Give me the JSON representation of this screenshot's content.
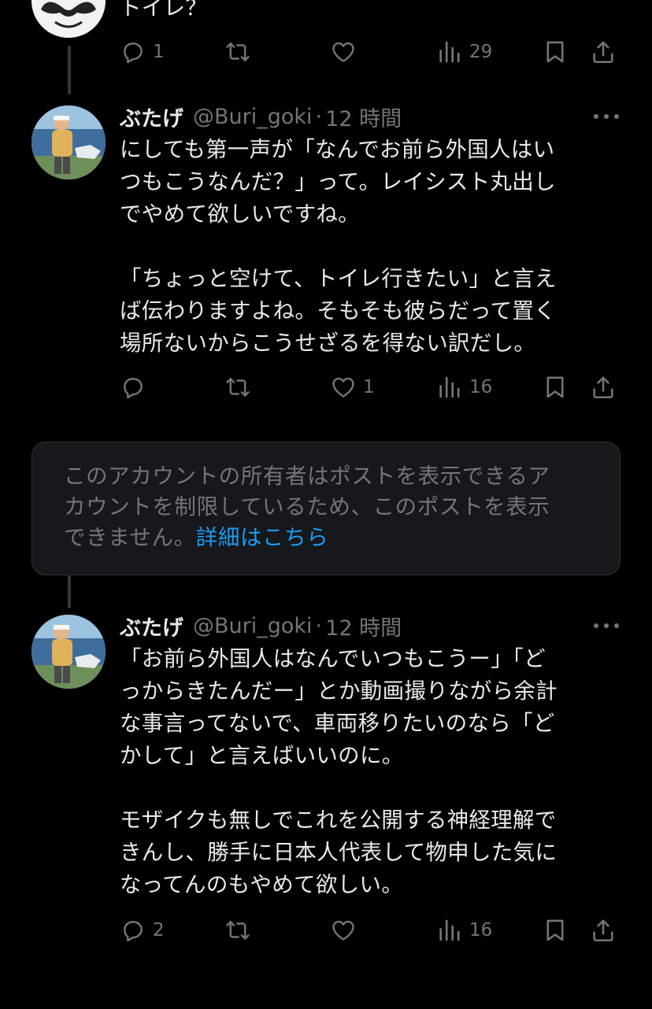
{
  "prev_tweet": {
    "text_tail": "トイレ？",
    "actions": {
      "reply_count": "1",
      "retweet_count": "",
      "like_count": "",
      "view_count": "29"
    }
  },
  "tweets": [
    {
      "name": "ぶたげ",
      "handle": "@Buri_goki",
      "dot": "·",
      "time": "12 時間",
      "lines_a": [
        "にしても第一声が「なんでお前ら外国人はい",
        "つもこうなんだ？」って。レイシスト丸出し",
        "でやめて欲しいですね。"
      ],
      "lines_b": [
        "「ちょっと空けて、トイレ行きたい」と言え",
        "ば伝わりますよね。そもそも彼らだって置く",
        "場所ないからこうせざるを得ない訳だし。"
      ],
      "actions": {
        "reply_count": "",
        "retweet_count": "",
        "like_count": "1",
        "view_count": "16"
      }
    },
    {
      "name": "ぶたげ",
      "handle": "@Buri_goki",
      "dot": "·",
      "time": "12 時間",
      "lines_a": [
        "「お前ら外国人はなんでいつもこうー」「ど",
        "っからきたんだー」とか動画撮りながら余計",
        "な事言ってないで、車両移りたいのなら「ど",
        "かして」と言えばいいのに。"
      ],
      "lines_b": [
        "モザイクも無しでこれを公開する神経理解で",
        "きんし、勝手に日本人代表して物申した気に",
        "なってんのもやめて欲しい。"
      ],
      "actions": {
        "reply_count": "2",
        "retweet_count": "",
        "like_count": "",
        "view_count": "16"
      }
    }
  ],
  "notice": {
    "line1": "このアカウントの所有者はポストを表示できるア",
    "line2": "カウントを制限しているため、このポストを表示",
    "line3_prefix": "できません。",
    "link": "詳細はこちら"
  },
  "icons": {
    "reply": "reply-icon",
    "retweet": "retweet-icon",
    "like": "like-icon",
    "views": "views-icon",
    "bookmark": "bookmark-icon",
    "share": "share-icon",
    "more": "more-icon"
  },
  "colors": {
    "background": "#000000",
    "text": "#e7e9ea",
    "muted": "#71767b",
    "link": "#1d9bf0",
    "notice_bg": "#16181c"
  }
}
